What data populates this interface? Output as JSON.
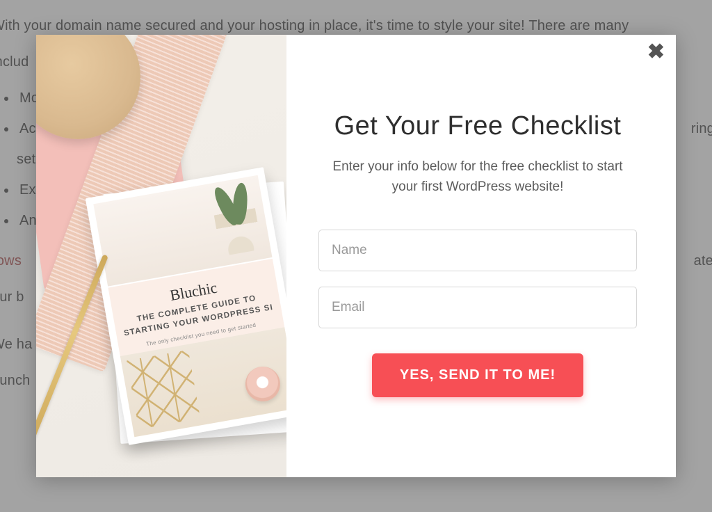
{
  "background": {
    "intro": "With your domain name secured and your hosting in place, it's time to style your site! There are many",
    "intro2": "includ",
    "bullets": [
      "Mo",
      "Acc",
      "set",
      "Exc",
      "Anc"
    ],
    "bullet_tail": "ring",
    "link_fragment": "rows",
    "after_link": "ate",
    "after_link2": "our b",
    "closing1": "We ha",
    "closing2": "aunch"
  },
  "modal": {
    "headline": "Get Your Free Checklist",
    "sub": "Enter your info below for the free checklist to start your first WordPress website!",
    "name_placeholder": "Name",
    "email_placeholder": "Email",
    "cta": "YES, SEND IT TO ME!",
    "close_glyph": "✖",
    "card": {
      "brand": "Bluchic",
      "title_line1": "THE COMPLETE GUIDE TO",
      "title_line2": "STARTING YOUR WORDPRESS SI",
      "sub": "The only checklist you need to get started"
    }
  }
}
